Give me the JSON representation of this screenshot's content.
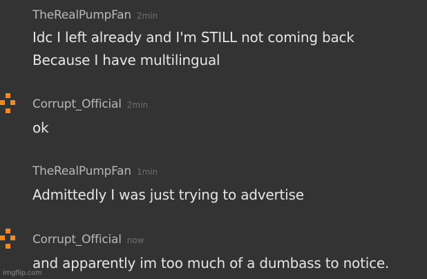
{
  "messages": [
    {
      "username": "TheRealPumpFan",
      "time": "2min",
      "lines": [
        "Idc I left already and I'm STILL not coming back",
        "Because I have multilingual"
      ]
    },
    {
      "username": "Corrupt_Official",
      "time": "2min",
      "lines": [
        "ok"
      ],
      "avatar_icon": "orange-pixel-avatar",
      "avatar_color": "#f28a1e"
    },
    {
      "username": "TheRealPumpFan",
      "time": "1min",
      "lines": [
        "Admittedly I was just trying to advertise"
      ]
    },
    {
      "username": "Corrupt_Official",
      "time": "now",
      "lines": [
        "and apparently im too much of a dumbass to notice."
      ],
      "avatar_icon": "orange-pixel-avatar",
      "avatar_color": "#f28a1e"
    }
  ],
  "watermark": "imgflip.com",
  "colors": {
    "background": "#333333",
    "username": "#b9b9b9",
    "timestamp": "#707070",
    "message_text": "#e6e6e6"
  }
}
